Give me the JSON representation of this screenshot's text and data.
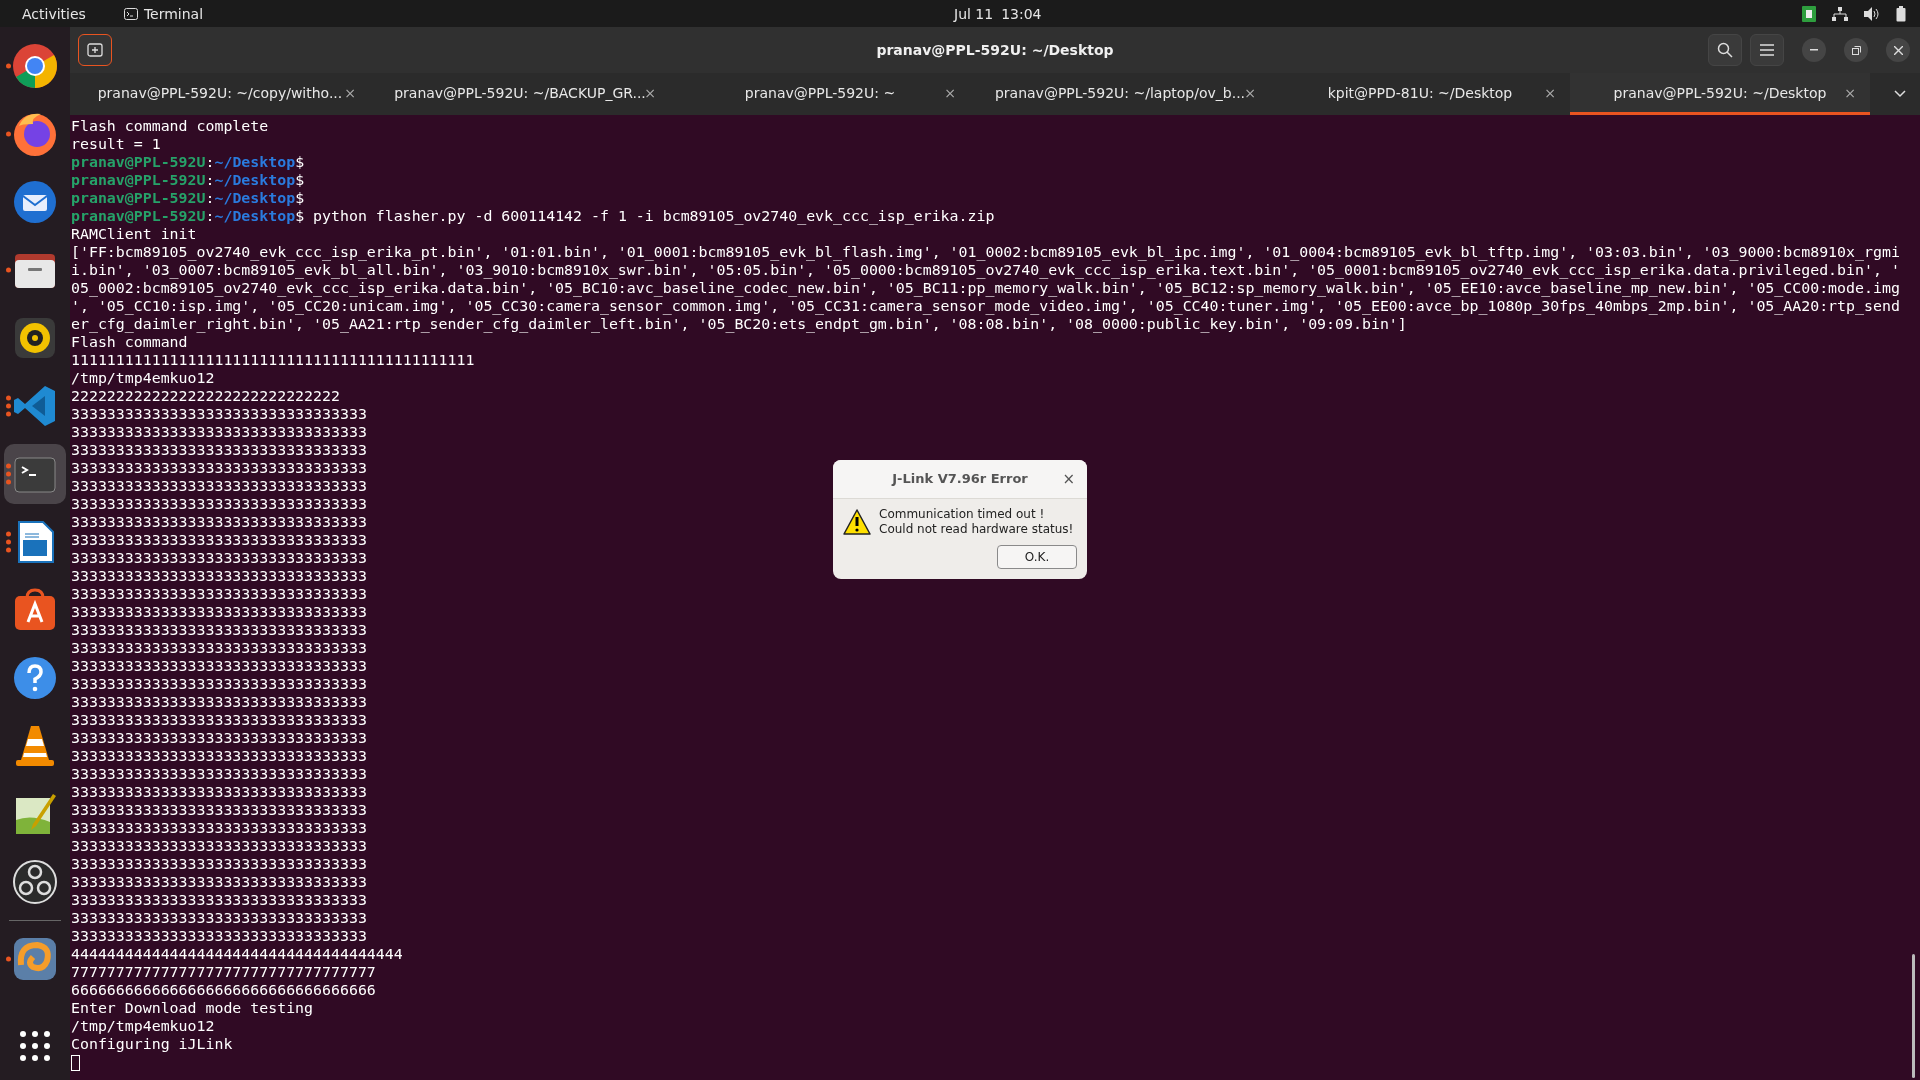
{
  "top_bar": {
    "activities": "Activities",
    "app_name": "Terminal",
    "date": "Jul 11",
    "time": "13:04"
  },
  "dock": {
    "items": [
      {
        "kind": "chrome",
        "running": true,
        "multi": false,
        "selected": false
      },
      {
        "kind": "firefox",
        "running": true,
        "multi": false,
        "selected": false
      },
      {
        "kind": "mail",
        "running": false,
        "selected": false
      },
      {
        "kind": "files",
        "running": true,
        "multi": false,
        "selected": false
      },
      {
        "kind": "music",
        "running": false,
        "selected": false
      },
      {
        "kind": "code",
        "running": true,
        "multi": true,
        "selected": false
      },
      {
        "kind": "terminal",
        "running": true,
        "multi": true,
        "selected": true
      },
      {
        "kind": "writer",
        "running": true,
        "multi": true,
        "selected": false
      },
      {
        "kind": "store",
        "running": false,
        "selected": false
      },
      {
        "kind": "help",
        "running": false,
        "selected": false
      },
      {
        "kind": "cone",
        "running": false,
        "selected": false
      },
      {
        "kind": "editor",
        "running": false,
        "selected": false
      },
      {
        "kind": "obs",
        "running": false,
        "selected": false
      },
      {
        "kind": "separator"
      },
      {
        "kind": "swirl",
        "running": true,
        "multi": false,
        "selected": false
      }
    ]
  },
  "window": {
    "title": "pranav@PPL-592U: ~/Desktop"
  },
  "tabs": [
    {
      "label": "pranav@PPL-592U: ~/copy/witho...",
      "close": "×",
      "selected": false
    },
    {
      "label": "pranav@PPL-592U: ~/BACKUP_GR...",
      "close": "×",
      "selected": false
    },
    {
      "label": "pranav@PPL-592U: ~",
      "close": "×",
      "selected": false
    },
    {
      "label": "pranav@PPL-592U: ~/laptop/ov_b...",
      "close": "×",
      "selected": false
    },
    {
      "label": "kpit@PPD-81U: ~/Desktop",
      "close": "×",
      "selected": false
    },
    {
      "label": "pranav@PPL-592U: ~/Desktop",
      "close": "×",
      "selected": true
    }
  ],
  "terminal": {
    "lines": [
      {
        "kind": "output",
        "text": "Flash command complete"
      },
      {
        "kind": "output",
        "text": "result = 1"
      },
      {
        "kind": "prompt",
        "user": "pranav@PPL-592U",
        "sep": ":",
        "path": "~/Desktop",
        "symbol": "$"
      },
      {
        "kind": "prompt",
        "user": "pranav@PPL-592U",
        "sep": ":",
        "path": "~/Desktop",
        "symbol": "$"
      },
      {
        "kind": "prompt",
        "user": "pranav@PPL-592U",
        "sep": ":",
        "path": "~/Desktop",
        "symbol": "$"
      },
      {
        "kind": "prompt",
        "user": "pranav@PPL-592U",
        "sep": ":",
        "path": "~/Desktop",
        "symbol": "$",
        "command": " python flasher.py -d 600114142 -f 1 -i bcm89105_ov2740_evk_ccc_isp_erika.zip"
      },
      {
        "kind": "output",
        "text": "RAMClient init"
      },
      {
        "kind": "output",
        "text": "['FF:bcm89105_ov2740_evk_ccc_isp_erika_pt.bin', '01:01.bin', '01_0001:bcm89105_evk_bl_flash.img', '01_0002:bcm89105_evk_bl_ipc.img', '01_0004:bcm89105_evk_bl_tftp.img', '03:03.bin', '03_9000:bcm8910x_rgmi"
      },
      {
        "kind": "output",
        "text": "i.bin', '03_0007:bcm89105_evk_bl_all.bin', '03_9010:bcm8910x_swr.bin', '05:05.bin', '05_0000:bcm89105_ov2740_evk_ccc_isp_erika.text.bin', '05_0001:bcm89105_ov2740_evk_ccc_isp_erika.data.privileged.bin', '"
      },
      {
        "kind": "output",
        "text": "05_0002:bcm89105_ov2740_evk_ccc_isp_erika.data.bin', '05_BC10:avc_baseline_codec_new.bin', '05_BC11:pp_memory_walk.bin', '05_BC12:sp_memory_walk.bin', '05_EE10:avce_baseline_mp_new.bin', '05_CC00:mode.img"
      },
      {
        "kind": "output",
        "text": "', '05_CC10:isp.img', '05_CC20:unicam.img', '05_CC30:camera_sensor_common.img', '05_CC31:camera_sensor_mode_video.img', '05_CC40:tuner.img', '05_EE00:avce_bp_1080p_30fps_40mbps_2mp.bin', '05_AA20:rtp_send"
      },
      {
        "kind": "output",
        "text": "er_cfg_daimler_right.bin', '05_AA21:rtp_sender_cfg_daimler_left.bin', '05_BC20:ets_endpt_gm.bin', '08:08.bin', '08_0000:public_key.bin', '09:09.bin']"
      },
      {
        "kind": "output",
        "text": "Flash command"
      },
      {
        "kind": "output",
        "text": "111111111111111111111111111111111111111111111"
      },
      {
        "kind": "output",
        "text": "/tmp/tmp4emkuo12"
      },
      {
        "kind": "output",
        "text": "222222222222222222222222222222"
      },
      {
        "kind": "output",
        "text": "333333333333333333333333333333333"
      },
      {
        "kind": "output",
        "text": "333333333333333333333333333333333"
      },
      {
        "kind": "output",
        "text": "333333333333333333333333333333333"
      },
      {
        "kind": "output",
        "text": "333333333333333333333333333333333"
      },
      {
        "kind": "output",
        "text": "333333333333333333333333333333333"
      },
      {
        "kind": "output",
        "text": "333333333333333333333333333333333"
      },
      {
        "kind": "output",
        "text": "333333333333333333333333333333333"
      },
      {
        "kind": "output",
        "text": "333333333333333333333333333333333"
      },
      {
        "kind": "output",
        "text": "333333333333333333333333333333333"
      },
      {
        "kind": "output",
        "text": "333333333333333333333333333333333"
      },
      {
        "kind": "output",
        "text": "333333333333333333333333333333333"
      },
      {
        "kind": "output",
        "text": "333333333333333333333333333333333"
      },
      {
        "kind": "output",
        "text": "333333333333333333333333333333333"
      },
      {
        "kind": "output",
        "text": "333333333333333333333333333333333"
      },
      {
        "kind": "output",
        "text": "333333333333333333333333333333333"
      },
      {
        "kind": "output",
        "text": "333333333333333333333333333333333"
      },
      {
        "kind": "output",
        "text": "333333333333333333333333333333333"
      },
      {
        "kind": "output",
        "text": "333333333333333333333333333333333"
      },
      {
        "kind": "output",
        "text": "333333333333333333333333333333333"
      },
      {
        "kind": "output",
        "text": "333333333333333333333333333333333"
      },
      {
        "kind": "output",
        "text": "333333333333333333333333333333333"
      },
      {
        "kind": "output",
        "text": "333333333333333333333333333333333"
      },
      {
        "kind": "output",
        "text": "333333333333333333333333333333333"
      },
      {
        "kind": "output",
        "text": "333333333333333333333333333333333"
      },
      {
        "kind": "output",
        "text": "333333333333333333333333333333333"
      },
      {
        "kind": "output",
        "text": "333333333333333333333333333333333"
      },
      {
        "kind": "output",
        "text": "333333333333333333333333333333333"
      },
      {
        "kind": "output",
        "text": "333333333333333333333333333333333"
      },
      {
        "kind": "output",
        "text": "333333333333333333333333333333333"
      },
      {
        "kind": "output",
        "text": "333333333333333333333333333333333"
      },
      {
        "kind": "output",
        "text": "4444444444444444444444444444444444444"
      },
      {
        "kind": "output",
        "text": "7777777777777777777777777777777777"
      },
      {
        "kind": "output",
        "text": "6666666666666666666666666666666666"
      },
      {
        "kind": "output",
        "text": "Enter Download mode testing"
      },
      {
        "kind": "output",
        "text": "/tmp/tmp4emkuo12"
      },
      {
        "kind": "output",
        "text": "Configuring iJLink"
      },
      {
        "kind": "cursor"
      }
    ]
  },
  "dialog": {
    "title": "J-Link V7.96r Error",
    "close": "×",
    "message": [
      "Communication timed out !",
      "Could not read hardware status!"
    ],
    "button": "O.K."
  }
}
